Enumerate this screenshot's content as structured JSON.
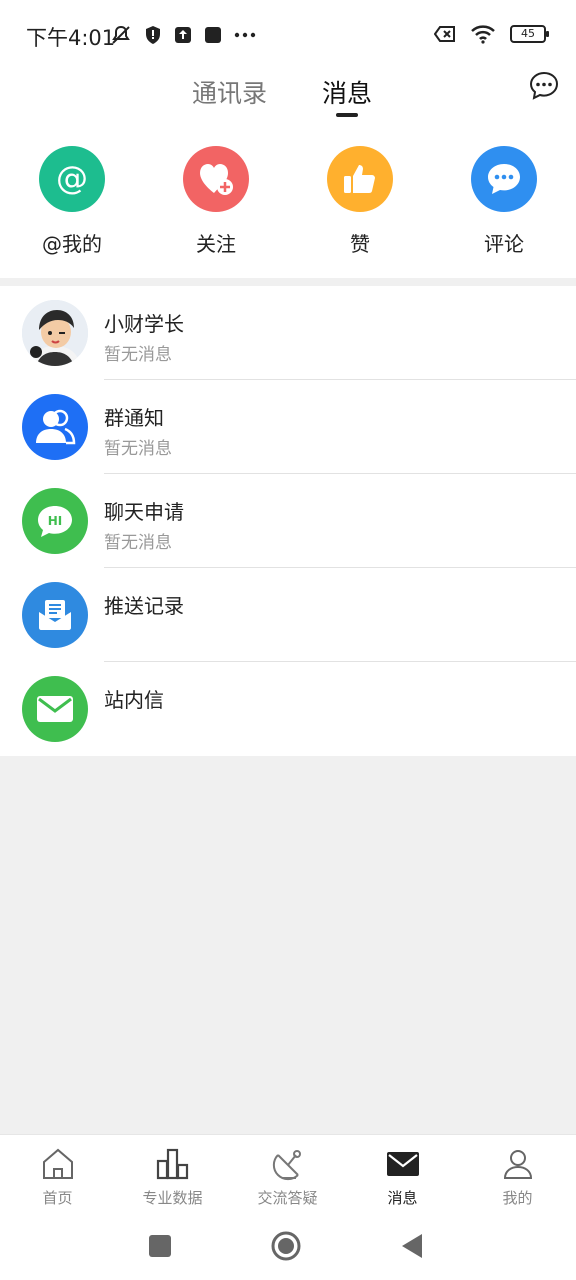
{
  "status_bar": {
    "time": "下午4:01",
    "battery": "45"
  },
  "header": {
    "tabs": [
      {
        "label": "通讯录"
      },
      {
        "label": "消息"
      }
    ],
    "active_tab": "消息"
  },
  "quick_actions": [
    {
      "label": "@我的",
      "icon": "at-icon",
      "color": "#1dbd8f"
    },
    {
      "label": "关注",
      "icon": "heart-plus-icon",
      "color": "#f26464"
    },
    {
      "label": "赞",
      "icon": "thumbs-up-icon",
      "color": "#ffb02e"
    },
    {
      "label": "评论",
      "icon": "comment-icon",
      "color": "#2f8ff0"
    }
  ],
  "messages": [
    {
      "title": "小财学长",
      "subtitle": "暂无消息",
      "icon": "user-avatar"
    },
    {
      "title": "群通知",
      "subtitle": "暂无消息",
      "icon": "group-icon",
      "color": "#1e6ff5"
    },
    {
      "title": "聊天申请",
      "subtitle": "暂无消息",
      "icon": "hi-bubble-icon",
      "color": "#3fbe4f"
    },
    {
      "title": "推送记录",
      "subtitle": "",
      "icon": "mail-open-icon",
      "color": "#2f8ae0"
    },
    {
      "title": "站内信",
      "subtitle": "",
      "icon": "envelope-icon",
      "color": "#3fbe4f"
    }
  ],
  "bottom_nav": [
    {
      "label": "首页",
      "icon": "home-icon"
    },
    {
      "label": "专业数据",
      "icon": "bar-chart-icon"
    },
    {
      "label": "交流答疑",
      "icon": "satellite-icon"
    },
    {
      "label": "消息",
      "icon": "envelope-icon",
      "active": true
    },
    {
      "label": "我的",
      "icon": "person-icon"
    }
  ]
}
